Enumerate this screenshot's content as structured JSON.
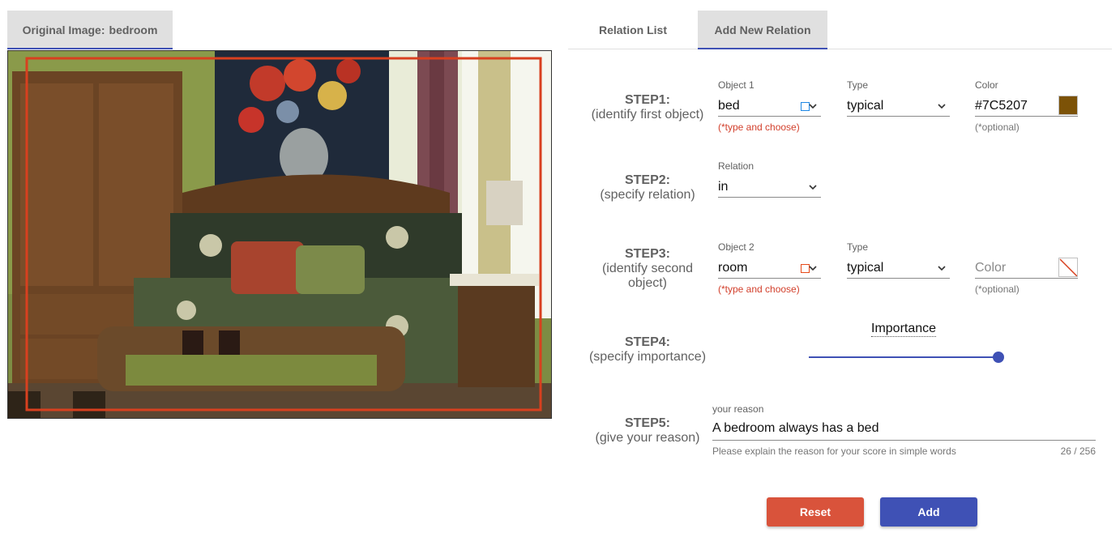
{
  "left_tab": {
    "label": "Original Image:",
    "value": "bedroom"
  },
  "tabs": [
    {
      "label": "Relation List"
    },
    {
      "label": "Add New Relation"
    }
  ],
  "steps": [
    {
      "title": "STEP1:",
      "desc": "(identify first object)"
    },
    {
      "title": "STEP2:",
      "desc": "(specify relation)"
    },
    {
      "title": "STEP3:",
      "desc": "(identify second object)"
    },
    {
      "title": "STEP4:",
      "desc": "(specify importance)"
    },
    {
      "title": "STEP5:",
      "desc": "(give your reason)"
    }
  ],
  "object1": {
    "label": "Object 1",
    "value": "bed",
    "hint": "(*type and choose)",
    "square_color": "#1e88e5"
  },
  "type1": {
    "label": "Type",
    "value": "typical"
  },
  "color1": {
    "label": "Color",
    "value": "#7C5207",
    "hint": "(*optional)"
  },
  "relation": {
    "label": "Relation",
    "value": "in"
  },
  "object2": {
    "label": "Object 2",
    "value": "room",
    "hint": "(*type and choose)",
    "square_color": "#e64a19"
  },
  "type2": {
    "label": "Type",
    "value": "typical"
  },
  "color2": {
    "placeholder": "Color",
    "hint": "(*optional)"
  },
  "importance": {
    "label": "Importance",
    "value": 1.0
  },
  "reason": {
    "label": "your reason",
    "value": "A bedroom always has a bed",
    "helper": "Please explain the reason for your score in simple words",
    "counter": "26 / 256"
  },
  "buttons": {
    "reset": "Reset",
    "add": "Add"
  },
  "colors": {
    "accent": "#3f51b5",
    "reset": "#d9533b",
    "required_hint": "#d23f2b",
    "bbox": "#d8401f"
  }
}
